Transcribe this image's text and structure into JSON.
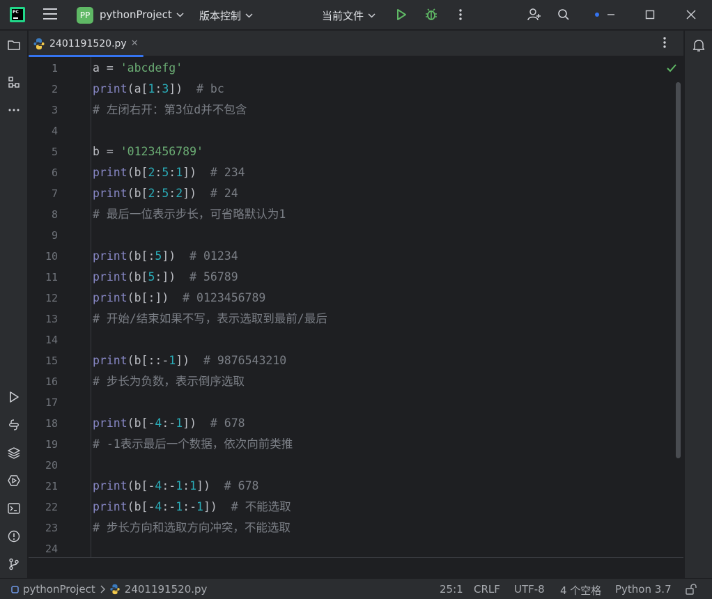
{
  "titlebar": {
    "logo_text": "PC",
    "project_badge": "PP",
    "project_name": "pythonProject",
    "vcs_label": "版本控制",
    "run_config": "当前文件"
  },
  "tab": {
    "label": "2401191520.py"
  },
  "editor": {
    "lines": [
      {
        "n": "1"
      },
      {
        "n": "2"
      },
      {
        "n": "3"
      },
      {
        "n": "4"
      },
      {
        "n": "5"
      },
      {
        "n": "6"
      },
      {
        "n": "7"
      },
      {
        "n": "8"
      },
      {
        "n": "9"
      },
      {
        "n": "10"
      },
      {
        "n": "11"
      },
      {
        "n": "12"
      },
      {
        "n": "13"
      },
      {
        "n": "14"
      },
      {
        "n": "15"
      },
      {
        "n": "16"
      },
      {
        "n": "17"
      },
      {
        "n": "18"
      },
      {
        "n": "19"
      },
      {
        "n": "20"
      },
      {
        "n": "21"
      },
      {
        "n": "22"
      },
      {
        "n": "23"
      },
      {
        "n": "24"
      }
    ],
    "code": [
      [
        [
          "",
          "a = "
        ],
        [
          "str",
          "'abcdefg'"
        ]
      ],
      [
        [
          "kw",
          "print"
        ],
        [
          "",
          "(a["
        ],
        [
          "num",
          "1"
        ],
        [
          "",
          ":"
        ],
        [
          "num",
          "3"
        ],
        [
          "",
          "])  "
        ],
        [
          "cmt",
          "# bc"
        ]
      ],
      [
        [
          "cmt",
          "# 左闭右开：第3位d并不包含"
        ]
      ],
      [],
      [
        [
          "",
          "b = "
        ],
        [
          "str",
          "'0123456789'"
        ]
      ],
      [
        [
          "kw",
          "print"
        ],
        [
          "",
          "(b["
        ],
        [
          "num",
          "2"
        ],
        [
          "",
          ":"
        ],
        [
          "num",
          "5"
        ],
        [
          "",
          ":"
        ],
        [
          "num",
          "1"
        ],
        [
          "",
          "])  "
        ],
        [
          "cmt",
          "# 234"
        ]
      ],
      [
        [
          "kw",
          "print"
        ],
        [
          "",
          "(b["
        ],
        [
          "num",
          "2"
        ],
        [
          "",
          ":"
        ],
        [
          "num",
          "5"
        ],
        [
          "",
          ":"
        ],
        [
          "num",
          "2"
        ],
        [
          "",
          "])  "
        ],
        [
          "cmt",
          "# 24"
        ]
      ],
      [
        [
          "cmt",
          "# 最后一位表示步长，可省略默认为1"
        ]
      ],
      [],
      [
        [
          "kw",
          "print"
        ],
        [
          "",
          "(b[:"
        ],
        [
          "num",
          "5"
        ],
        [
          "",
          "])  "
        ],
        [
          "cmt",
          "# 01234"
        ]
      ],
      [
        [
          "kw",
          "print"
        ],
        [
          "",
          "(b["
        ],
        [
          "num",
          "5"
        ],
        [
          "",
          ":])  "
        ],
        [
          "cmt",
          "# 56789"
        ]
      ],
      [
        [
          "kw",
          "print"
        ],
        [
          "",
          "(b[:])  "
        ],
        [
          "cmt",
          "# 0123456789"
        ]
      ],
      [
        [
          "cmt",
          "# 开始/结束如果不写，表示选取到最前/最后"
        ]
      ],
      [],
      [
        [
          "kw",
          "print"
        ],
        [
          "",
          "(b[::-"
        ],
        [
          "num",
          "1"
        ],
        [
          "",
          "])  "
        ],
        [
          "cmt",
          "# 9876543210"
        ]
      ],
      [
        [
          "cmt",
          "# 步长为负数，表示倒序选取"
        ]
      ],
      [],
      [
        [
          "kw",
          "print"
        ],
        [
          "",
          "(b[-"
        ],
        [
          "num",
          "4"
        ],
        [
          "",
          ":-"
        ],
        [
          "num",
          "1"
        ],
        [
          "",
          "])  "
        ],
        [
          "cmt",
          "# 678"
        ]
      ],
      [
        [
          "cmt",
          "# -1表示最后一个数据，依次向前类推"
        ]
      ],
      [],
      [
        [
          "kw",
          "print"
        ],
        [
          "",
          "(b[-"
        ],
        [
          "num",
          "4"
        ],
        [
          "",
          ":-"
        ],
        [
          "num",
          "1"
        ],
        [
          "",
          ":"
        ],
        [
          "num",
          "1"
        ],
        [
          "",
          "])  "
        ],
        [
          "cmt",
          "# 678"
        ]
      ],
      [
        [
          "kw",
          "print"
        ],
        [
          "",
          "(b[-"
        ],
        [
          "num",
          "4"
        ],
        [
          "",
          ":-"
        ],
        [
          "num",
          "1"
        ],
        [
          "",
          ":-"
        ],
        [
          "num",
          "1"
        ],
        [
          "",
          "])  "
        ],
        [
          "cmt",
          "# 不能选取"
        ]
      ],
      [
        [
          "cmt",
          "# 步长方向和选取方向冲突，不能选取"
        ]
      ],
      []
    ]
  },
  "statusbar": {
    "project": "pythonProject",
    "file": "2401191520.py",
    "position": "25:1",
    "line_sep": "CRLF",
    "encoding": "UTF-8",
    "indent": "4 个空格",
    "interpreter": "Python 3.7"
  },
  "icons": {
    "left_strip_top": [
      "folder-icon",
      "structure-icon",
      "more-icon"
    ],
    "left_strip_bottom": [
      "run-icon",
      "python-console-icon",
      "layers-icon",
      "services-icon",
      "terminal-icon",
      "problems-icon",
      "git-icon"
    ],
    "right_strip": [
      "notifications-icon"
    ]
  },
  "colors": {
    "accent": "#3574f0",
    "keyword": "#8888c6",
    "string": "#6aab73",
    "number": "#2aacb8",
    "comment": "#7a7e85",
    "run_green": "#5fb865"
  }
}
